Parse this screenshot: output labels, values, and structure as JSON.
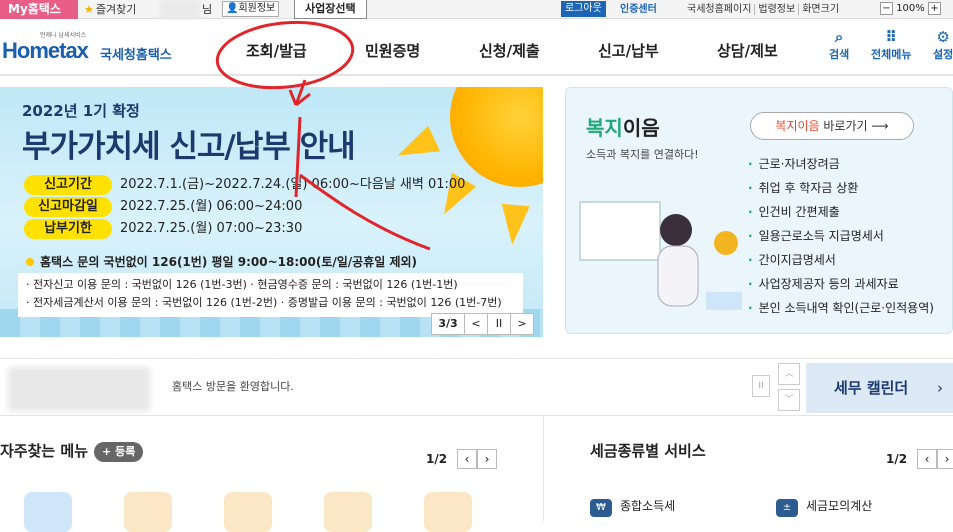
{
  "topbar": {
    "my_hometax": "My홈택스",
    "favorites": "즐겨찾기",
    "nim": "님",
    "member_info": "회원정보",
    "business_select": "사업장선택",
    "logout": "로그아웃",
    "cert_center": "인증센터",
    "links": [
      "국세청홈페이지",
      "법령정보",
      "화면크기"
    ],
    "zoom": "100%"
  },
  "logo": {
    "brand": "Hometax",
    "korean": "국세청홈택스",
    "tagline": "언제나 납세서비스"
  },
  "nav": {
    "items": [
      "조회/발급",
      "민원증명",
      "신청/제출",
      "신고/납부",
      "상담/제보"
    ]
  },
  "tools": {
    "search": "검색",
    "all_menu": "전체메뉴",
    "settings": "설정"
  },
  "banner": {
    "subtitle": "2022년 1기 확정",
    "title": "부가가치세 신고/납부 안내",
    "rows": [
      {
        "label": "신고기간",
        "value": "2022.7.1.(금)~2022.7.24.(일) 06:00~다음날 새벽 01:00"
      },
      {
        "label": "신고마감일",
        "value": "2022.7.25.(월) 06:00~24:00"
      },
      {
        "label": "납부기한",
        "value": "2022.7.25.(월) 07:00~23:30"
      }
    ],
    "note": "홈택스 문의 국번없이 126(1번)    평일 9:00~18:00(토/일/공휴일 제외)",
    "info_lines": [
      "· 전자신고 이용 문의 : 국번없이 126 (1번-3번)      · 현금영수증 문의 : 국번없이 126 (1번-1번)",
      "· 전자세금계산서 이용 문의 : 국번없이 126 (1번-2번)  · 증명발급 이용 문의 : 국번없이 126 (1번-7번)"
    ],
    "page": "3/3",
    "prev": "<",
    "pause": "II",
    "next": ">"
  },
  "welfare": {
    "title_green": "복지",
    "title_rest": "이음",
    "subtitle": "소득과 복지를 연결하다!",
    "button_em": "복지이음",
    "button_rest": " 바로가기",
    "items": [
      "근로·자녀장려금",
      "취업 후 학자금 상환",
      "인건비 간편제출",
      "일용근로소득 지급명세서",
      "간이지급명세서",
      "사업장제공자 등의 과세자료",
      "본인 소득내역 확인(근로·인적용역)"
    ]
  },
  "welcome": {
    "message": "홈택스 방문을 환영합니다.",
    "calendar": "세무 캘린더"
  },
  "freq": {
    "title": "자주찾는 메뉴",
    "register": "+ 등록",
    "page": "1/2"
  },
  "tax": {
    "title": "세금종류별 서비스",
    "page": "1/2",
    "items": [
      "종합소득세",
      "세금모의계산"
    ]
  },
  "colors": {
    "brand_blue": "#1b64b6",
    "pink": "#e85e87",
    "yellow": "#ffe100",
    "green": "#1fa87a"
  }
}
